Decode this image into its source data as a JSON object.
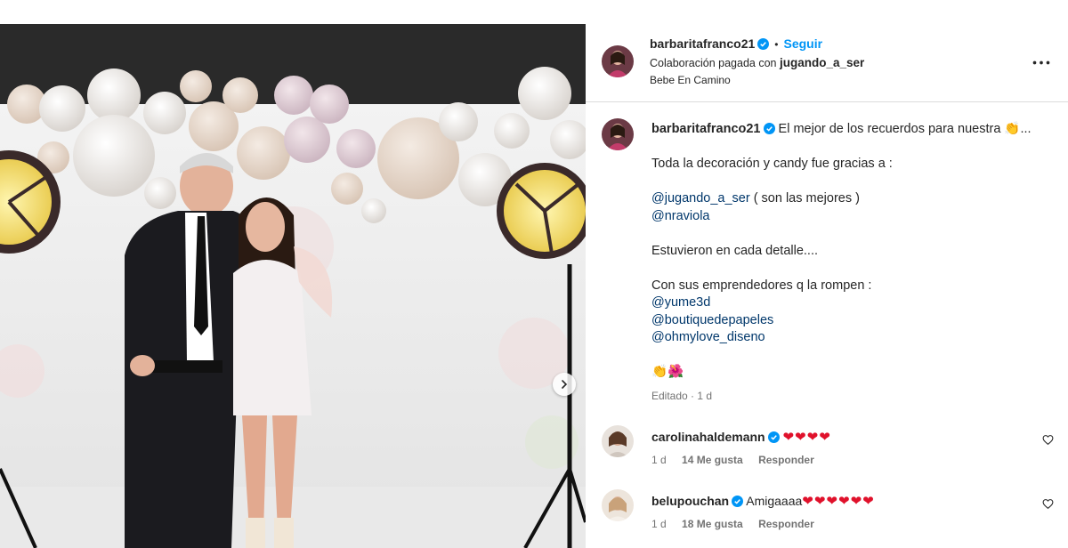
{
  "post": {
    "username": "barbaritafranco21",
    "follow_label": "Seguir",
    "dot": "•",
    "collab_prefix": "Colaboración pagada con",
    "collab_partner": "jugando_a_ser",
    "location": "Bebe En Camino",
    "more_label": "•••"
  },
  "caption": {
    "username": "barbaritafranco21",
    "first_line": "El mejor de los recuerdos para nuestra 👏...",
    "line_decor": "Toda la decoración y candy fue gracias a :",
    "mention_1": "@jugando_a_ser",
    "mention_1_suffix": " ( son las mejores )",
    "mention_2": "@nraviola",
    "line_detail": "Estuvieron en cada detalle....",
    "line_entre": "Con sus emprendedores q la rompen :",
    "mention_3": "@yume3d",
    "mention_4": "@boutiquedepapeles",
    "mention_5": "@ohmylove_diseno",
    "emoji_line": "👏🌺",
    "meta": "Editado · 1 d"
  },
  "comments": [
    {
      "username": "carolinahaldemann",
      "text": "",
      "hearts": "❤❤❤❤",
      "time": "1 d",
      "likes": "14 Me gusta",
      "reply": "Responder"
    },
    {
      "username": "belupouchan",
      "text": "Amigaaaa",
      "hearts": "❤❤❤❤❤❤",
      "time": "1 d",
      "likes": "18 Me gusta",
      "reply": "Responder"
    }
  ],
  "colors": {
    "verified": "#0095f6",
    "follow": "#0095f6",
    "mention": "#00376b",
    "heart": "#e0112b"
  },
  "icons": {
    "verified": "verified-badge-icon",
    "more": "more-options-icon",
    "like": "heart-outline-icon",
    "next": "chevron-right-icon"
  }
}
